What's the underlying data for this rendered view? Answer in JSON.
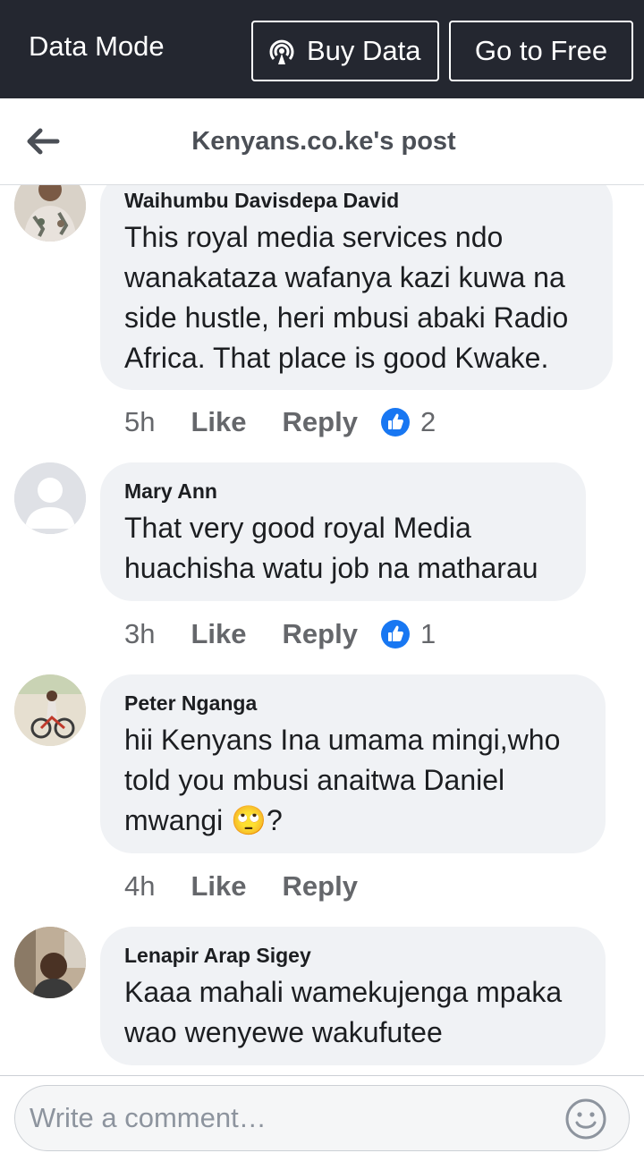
{
  "topbar": {
    "mode_label": "Data Mode",
    "buy_label": "Buy Data",
    "free_label": "Go to Free",
    "background": "#242730"
  },
  "header": {
    "title": "Kenyans.co.ke's post"
  },
  "comments": [
    {
      "author": "Waihumbu Davisdepa David",
      "text": "This royal media services ndo wanakataza wafanya kazi kuwa na side hustle, heri mbusi abaki Radio Africa. That place is good Kwake.",
      "time": "5h",
      "like": "Like",
      "reply": "Reply",
      "reactions": "2"
    },
    {
      "author": "Mary Ann",
      "text": "That very good royal Media huachisha watu job na matharau",
      "time": "3h",
      "like": "Like",
      "reply": "Reply",
      "reactions": "1"
    },
    {
      "author": "Peter Nganga",
      "text": "hii Kenyans Ina umama mingi,who told you mbusi anaitwa Daniel mwangi 🙄?",
      "time": "4h",
      "like": "Like",
      "reply": "Reply"
    },
    {
      "author": "Lenapir Arap Sigey",
      "text": "Kaaa mahali wamekujenga mpaka wao wenyewe wakufutee"
    }
  ],
  "composer": {
    "placeholder": "Write a comment…"
  },
  "colors": {
    "bubble": "#f0f2f5",
    "like_blue": "#1877f2",
    "muted": "#65676b"
  }
}
